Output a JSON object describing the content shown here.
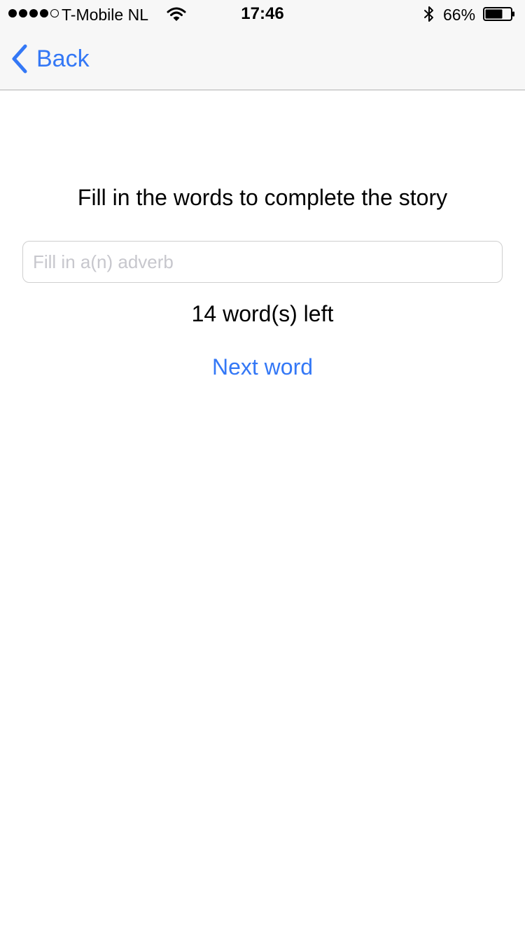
{
  "status_bar": {
    "carrier": "T-Mobile NL",
    "time": "17:46",
    "battery_percent": "66%",
    "signal_bars_filled": 4,
    "signal_bars_total": 5,
    "icons": [
      "signal-dots-icon",
      "wifi-icon",
      "bluetooth-icon",
      "battery-icon"
    ]
  },
  "nav": {
    "back_label": "Back"
  },
  "content": {
    "heading": "Fill in the words to complete the story",
    "input_value": "",
    "input_placeholder": "Fill in a(n) adverb",
    "words_left": "14 word(s) left",
    "next_label": "Next word"
  },
  "colors": {
    "accent": "#3478f6",
    "nav_background": "#f7f7f7",
    "placeholder": "#c7c7cd"
  }
}
